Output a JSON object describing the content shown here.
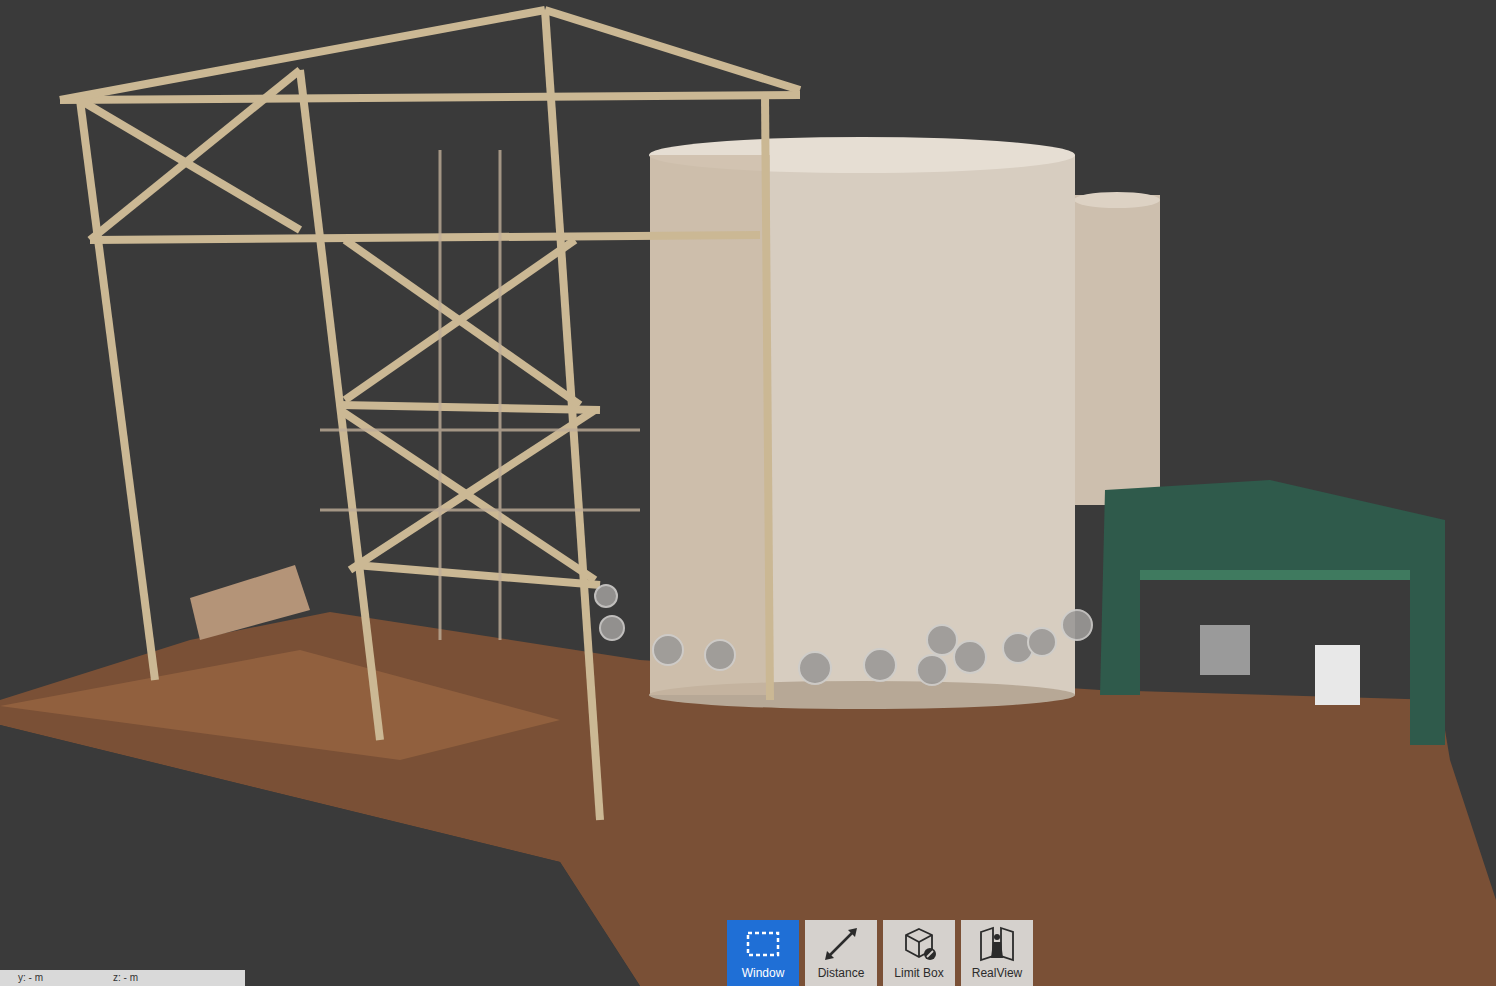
{
  "toolbar": {
    "tools": [
      {
        "label": "Window",
        "selected": true
      },
      {
        "label": "Distance",
        "selected": false
      },
      {
        "label": "Limit Box",
        "selected": false
      },
      {
        "label": "RealView",
        "selected": false
      }
    ]
  },
  "status_bar": [
    "y: - m",
    "z: - m"
  ]
}
